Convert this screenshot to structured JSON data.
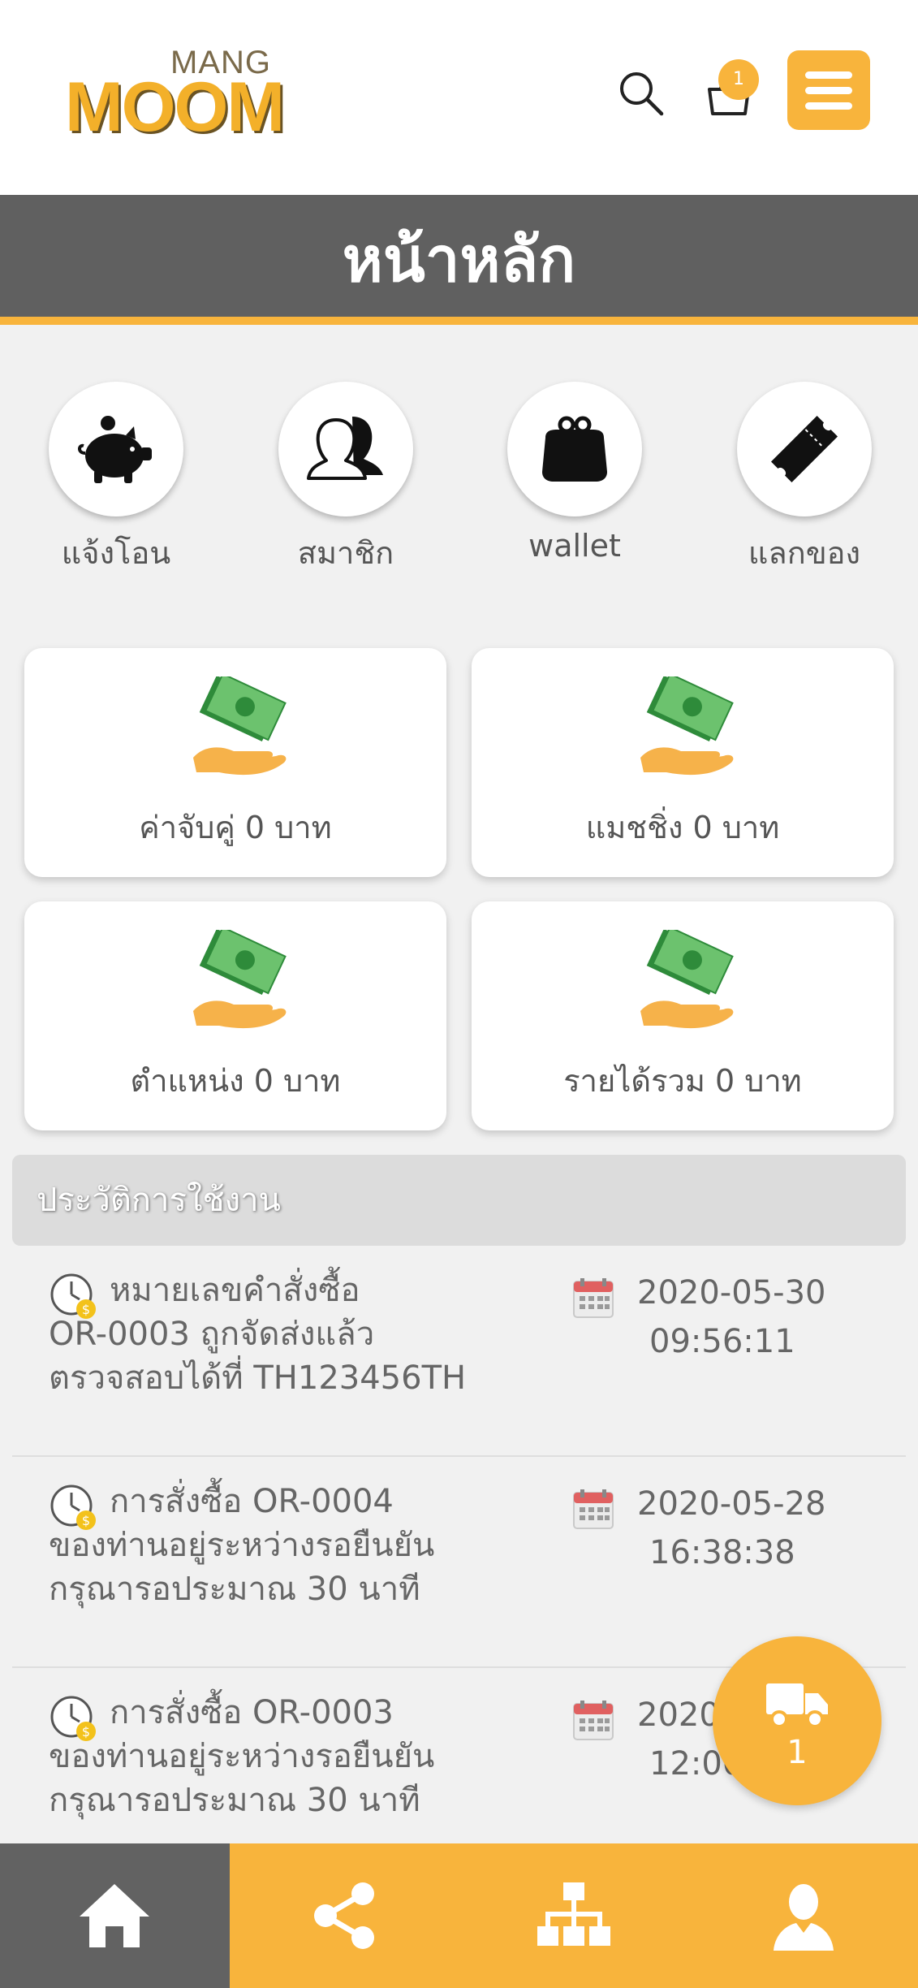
{
  "header": {
    "logo_small": "MANG",
    "logo_big": "MOOM",
    "cart_count": "1",
    "icons": [
      "search-icon",
      "shopping-bag-icon",
      "hamburger-menu-icon"
    ]
  },
  "page_title": "หน้าหลัก",
  "quick_actions": [
    {
      "label": "แจ้งโอน",
      "icon": "piggy-bank-icon"
    },
    {
      "label": "สมาชิก",
      "icon": "members-icon"
    },
    {
      "label": "wallet",
      "icon": "wallet-icon"
    },
    {
      "label": "แลกของ",
      "icon": "ticket-icon"
    }
  ],
  "cards": [
    {
      "label": "ค่าจับคู่ 0 บาท",
      "icon": "money-hand-icon"
    },
    {
      "label": "แมชชิ่ง 0 บาท",
      "icon": "money-hand-icon"
    },
    {
      "label": "ตำแหน่ง 0 บาท",
      "icon": "money-hand-icon"
    },
    {
      "label": "รายได้รวม 0 บาท",
      "icon": "money-hand-icon"
    }
  ],
  "history": {
    "title": "ประวัติการใช้งาน",
    "items": [
      {
        "line1": "หมายเลขคำสั่งซื้อ",
        "line2": "OR-0003 ถูกจัดส่งแล้ว",
        "line3": "ตรวจสอบได้ที่ TH123456TH",
        "date": "2020-05-30",
        "time": "09:56:11"
      },
      {
        "line1": "การสั่งซื้อ OR-0004",
        "line2": "ของท่านอยู่ระหว่างรอยืนยัน",
        "line3": "กรุณารอประมาณ 30 นาที",
        "date": "2020-05-28",
        "time": "16:38:38"
      },
      {
        "line1": "การสั่งซื้อ OR-0003",
        "line2": "ของท่านอยู่ระหว่างรอยืนยัน",
        "line3": "กรุณารอประมาณ 30 นาที",
        "date": "2020-05-28",
        "time": "12:00:00"
      }
    ]
  },
  "fab": {
    "count": "1",
    "icon": "delivery-truck-icon"
  },
  "bottom_nav": [
    {
      "icon": "home-icon",
      "active": true
    },
    {
      "icon": "share-icon",
      "active": false
    },
    {
      "icon": "org-chart-icon",
      "active": false
    },
    {
      "icon": "user-icon",
      "active": false
    }
  ],
  "colors": {
    "accent": "#f8b43c",
    "title_bar": "#606060",
    "background": "#f1f1f1"
  }
}
